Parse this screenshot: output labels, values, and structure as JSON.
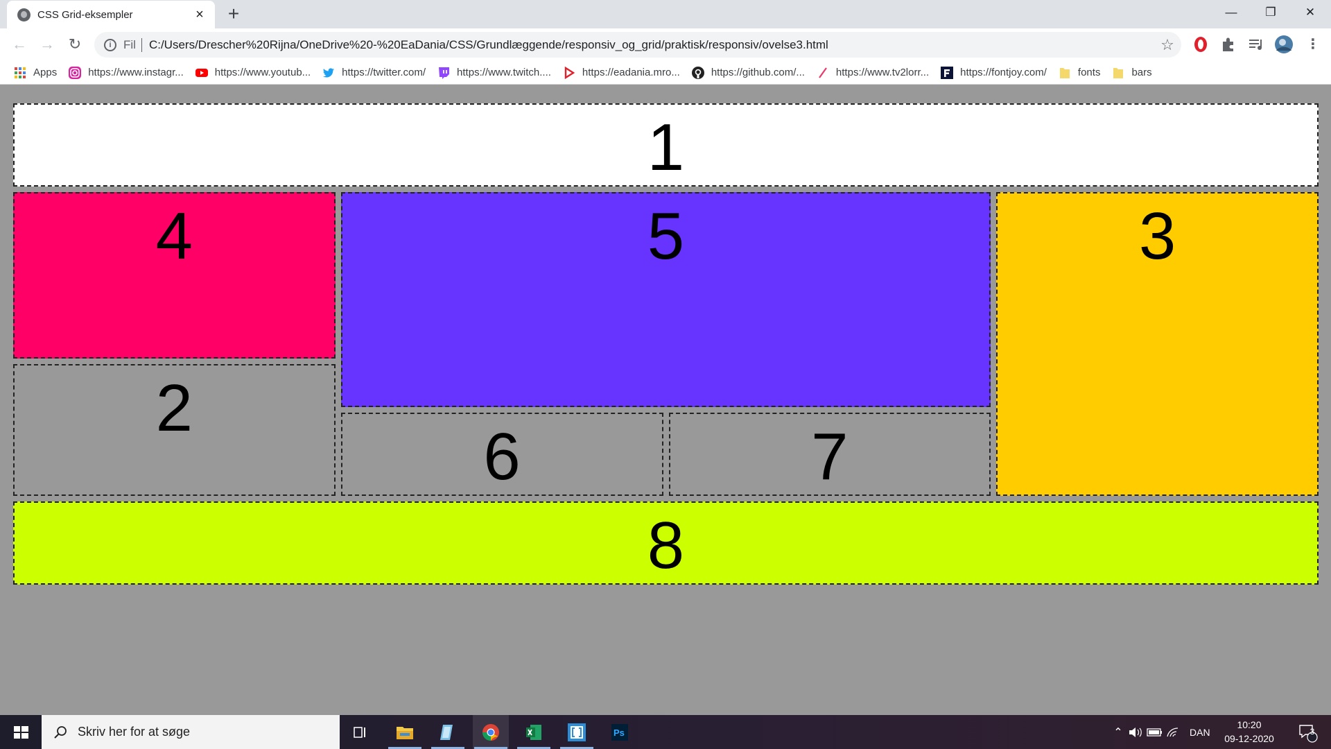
{
  "browser": {
    "tab": {
      "title": "CSS Grid-eksempler",
      "close": "×"
    },
    "new_tab": "+",
    "window_controls": {
      "minimize": "—",
      "maximize": "❐",
      "close": "✕"
    },
    "nav": {
      "back": "←",
      "forward": "→",
      "reload": "↻"
    },
    "omnibox": {
      "scheme": "Fil",
      "url": "C:/Users/Drescher%20Rijna/OneDrive%20-%20EaDania/CSS/Grundlæggende/responsiv_og_grid/praktisk/responsiv/ovelse3.html",
      "star": "☆"
    },
    "bookmarks": [
      {
        "label": "Apps",
        "icon": "apps-grid-icon"
      },
      {
        "label": "https://www.instagr...",
        "icon": "instagram-icon"
      },
      {
        "label": "https://www.youtub...",
        "icon": "youtube-icon"
      },
      {
        "label": "https://twitter.com/",
        "icon": "twitter-icon"
      },
      {
        "label": "https://www.twitch....",
        "icon": "twitch-icon"
      },
      {
        "label": "https://eadania.mro...",
        "icon": "eadania-icon"
      },
      {
        "label": "https://github.com/...",
        "icon": "github-icon"
      },
      {
        "label": "https://www.tv2lorr...",
        "icon": "tv2-icon"
      },
      {
        "label": "https://fontjoy.com/",
        "icon": "fontjoy-icon"
      },
      {
        "label": "fonts",
        "icon": "folder-icon"
      },
      {
        "label": "bars",
        "icon": "folder-icon"
      }
    ]
  },
  "grid": {
    "cells": [
      {
        "id": "1",
        "color": "#ffffff"
      },
      {
        "id": "2",
        "color": "#999999"
      },
      {
        "id": "3",
        "color": "#ffcc00"
      },
      {
        "id": "4",
        "color": "#ff0066"
      },
      {
        "id": "5",
        "color": "#6633ff"
      },
      {
        "id": "6",
        "color": "#999999"
      },
      {
        "id": "7",
        "color": "#999999"
      },
      {
        "id": "8",
        "color": "#ccff00"
      }
    ]
  },
  "taskbar": {
    "search_placeholder": "Skriv her for at søge",
    "language": "DAN",
    "time": "10:20",
    "date": "09-12-2020",
    "notifications": "3"
  }
}
